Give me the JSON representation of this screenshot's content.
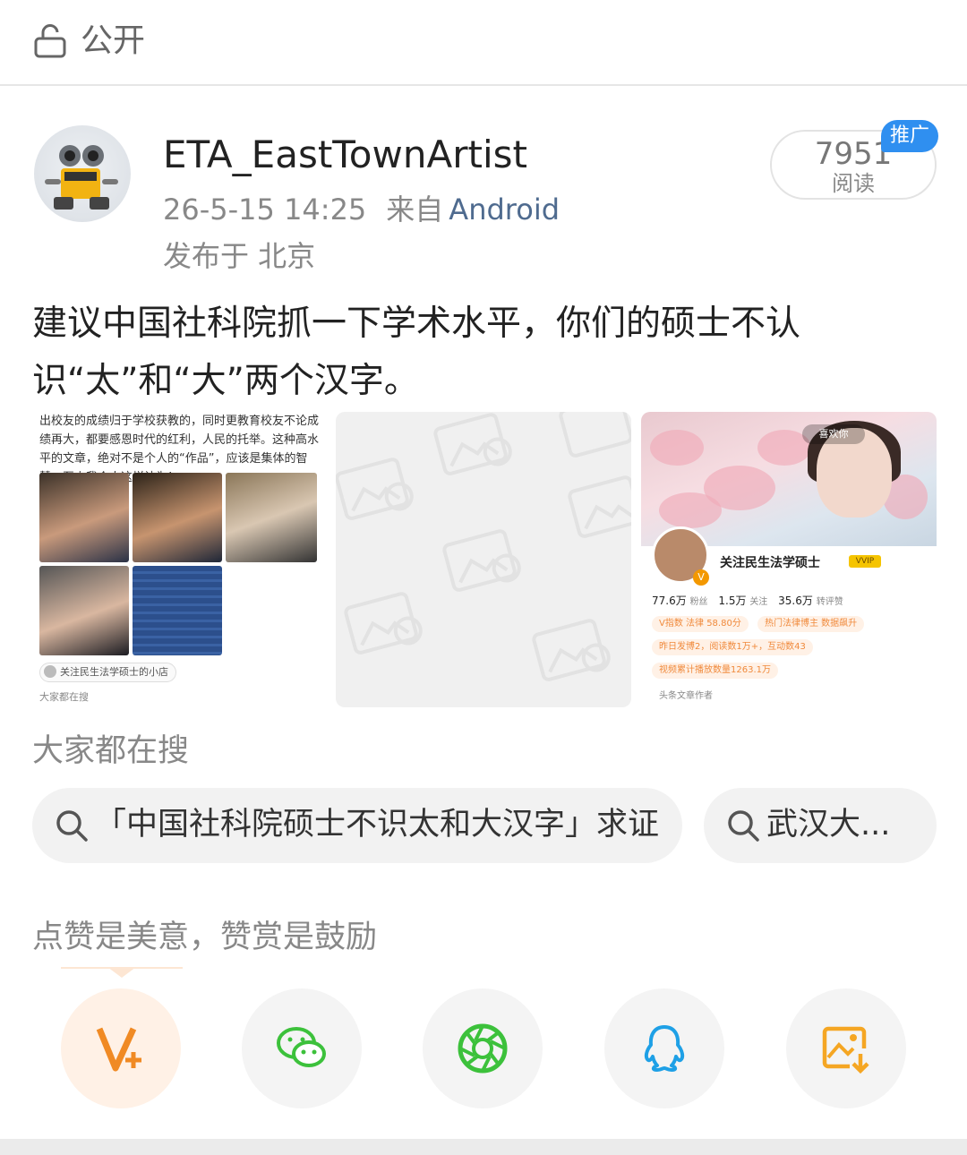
{
  "header": {
    "visibility_label": "公开",
    "lock_icon": "lock-open-icon"
  },
  "post": {
    "author": "ETA_EastTownArtist",
    "time": "26-5-15 14:25",
    "source_prefix": "来自",
    "source": "Android",
    "location": "发布于 北京",
    "reads_count": "7951",
    "reads_label": "阅读",
    "promo_badge": "推广",
    "text": "建议中国社科院抓一下学术水平，你们的硕士不认识“太”和“大”两个汉字。"
  },
  "images": {
    "img1": {
      "text": "出校友的成绩归于学校获教的，同时更教育校友不论成绩再大，都要感恩时代的红利，人民的托举。这种高水平的文章，绝对不是个人的“作品”，应该是集体的智慧，至少我个人这样认为！",
      "shop": "关注民生法学硕士的小店",
      "footer": "大家都在搜"
    },
    "img3": {
      "like_pill": "喜欢你",
      "profile_name": "关注民生法学硕士",
      "vip_label": "VVIP",
      "verify_badge": "V",
      "followers": "77.6万",
      "followers_label": "粉丝",
      "following": "1.5万",
      "following_label": "关注",
      "likes": "35.6万",
      "likes_label": "转评赞",
      "tag1": "V指数 法律 58.80分",
      "tag2": "热门法律博主 数据飙升",
      "tag3": "昨日发博2，阅读数1万+，互动数43",
      "tag4": "视频累计播放数量1263.1万",
      "author_tag": "头条文章作者"
    }
  },
  "search": {
    "title": "大家都在搜",
    "chips": [
      "「中国社科院硕士不识太和大汉字」求证",
      "武汉大..."
    ]
  },
  "support": {
    "title": "点赞是美意，赞赏是鼓励",
    "actions": [
      {
        "icon": "v-plus-icon",
        "color": "#f08a24"
      },
      {
        "icon": "wechat-icon",
        "color": "#3cc13b"
      },
      {
        "icon": "moments-icon",
        "color": "#3cc13b"
      },
      {
        "icon": "qq-icon",
        "color": "#1ea0e6"
      },
      {
        "icon": "save-image-icon",
        "color": "#f5a623"
      }
    ]
  }
}
